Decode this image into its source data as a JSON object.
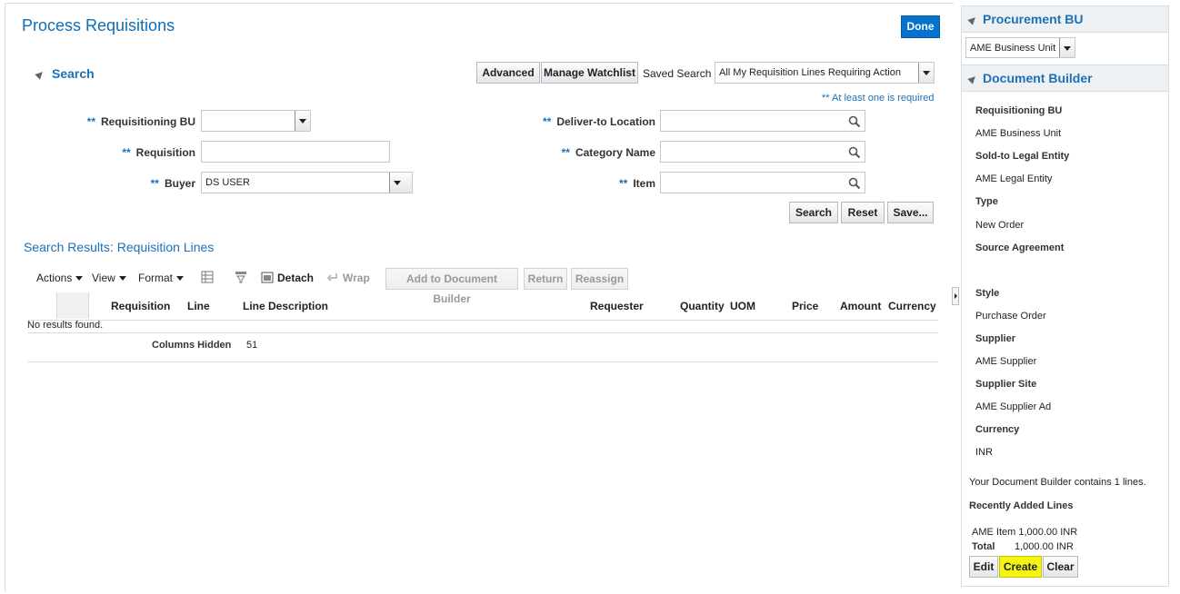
{
  "page": {
    "title": "Process Requisitions",
    "done_label": "Done"
  },
  "search": {
    "heading": "Search",
    "advanced_label": "Advanced",
    "manage_watchlist_label": "Manage Watchlist",
    "saved_search_label": "Saved Search",
    "saved_search_value": "All My Requisition Lines Requiring Action",
    "required_hint": "** At least one is required",
    "required_marker": "**",
    "fields": {
      "requisitioning_bu": {
        "label": "Requisitioning BU",
        "value": ""
      },
      "requisition": {
        "label": "Requisition",
        "value": ""
      },
      "buyer": {
        "label": "Buyer",
        "value": "DS USER"
      },
      "deliver_to_location": {
        "label": "Deliver-to Location",
        "value": ""
      },
      "category_name": {
        "label": "Category Name",
        "value": ""
      },
      "item": {
        "label": "Item",
        "value": ""
      }
    },
    "search_button": "Search",
    "reset_button": "Reset",
    "save_button": "Save..."
  },
  "results": {
    "title": "Search Results: Requisition Lines",
    "toolbar": {
      "actions": "Actions",
      "view": "View",
      "format": "Format",
      "detach": "Detach",
      "wrap": "Wrap",
      "add_to_document_builder": "Add to Document Builder",
      "return": "Return",
      "reassign": "Reassign"
    },
    "columns": [
      "Requisition",
      "Line",
      "Line Description",
      "Requester",
      "Quantity",
      "UOM",
      "Price",
      "Amount",
      "Currency"
    ],
    "empty_message": "No results found.",
    "columns_hidden_label": "Columns Hidden",
    "columns_hidden_value": "51"
  },
  "side": {
    "procurement_bu": {
      "heading": "Procurement BU",
      "value": "AME Business Unit"
    },
    "document_builder": {
      "heading": "Document Builder",
      "fields": [
        {
          "label": "Requisitioning BU",
          "value": "AME Business Unit"
        },
        {
          "label": "Sold-to Legal Entity",
          "value": "AME Legal Entity"
        },
        {
          "label": "Type",
          "value": "New Order"
        },
        {
          "label": "Source Agreement",
          "value": ""
        },
        {
          "label": "Style",
          "value": "Purchase Order"
        },
        {
          "label": "Supplier",
          "value": "AME Supplier"
        },
        {
          "label": "Supplier Site",
          "value": "AME Supplier Ad"
        },
        {
          "label": "Currency",
          "value": "INR"
        }
      ],
      "summary": "Your Document Builder contains 1 lines.",
      "recent_heading": "Recently Added Lines",
      "recent_line": "AME Item 1,000.00 INR",
      "total_label": "Total",
      "total_value": "1,000.00 INR",
      "edit_button": "Edit",
      "create_button": "Create",
      "clear_button": "Clear"
    }
  }
}
